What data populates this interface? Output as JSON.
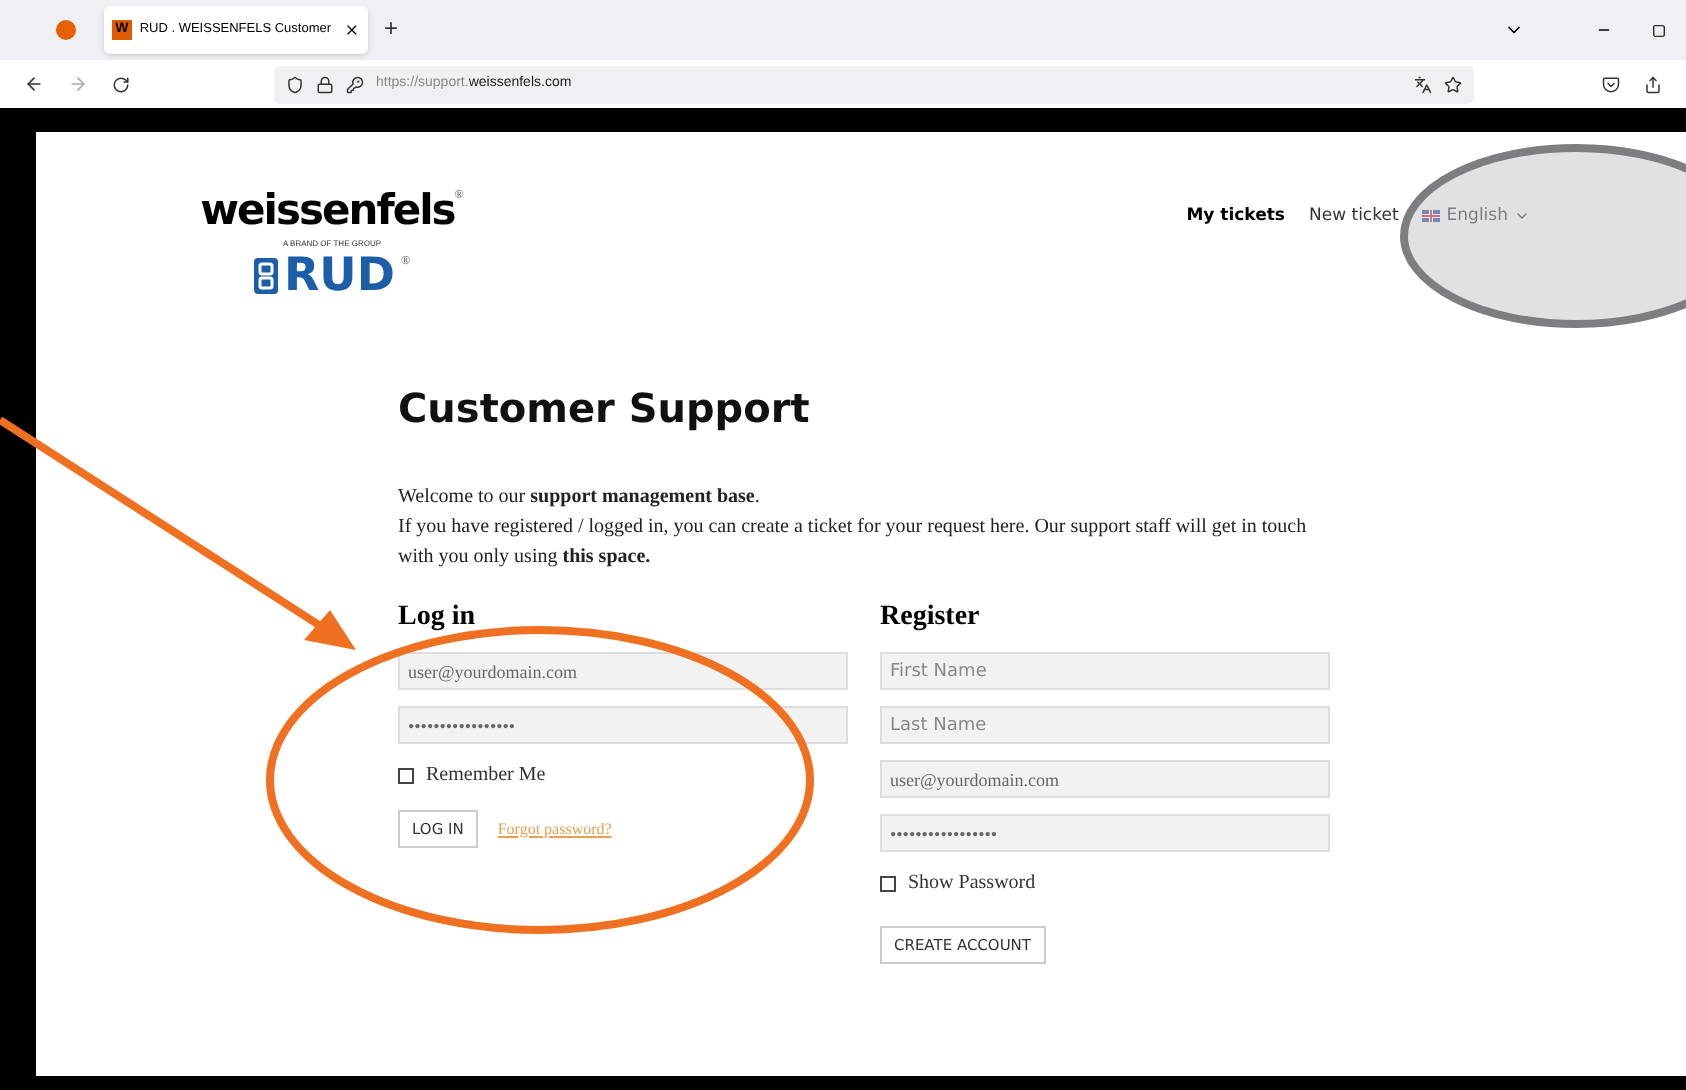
{
  "browser": {
    "tab": {
      "favicon": "W",
      "title": "RUD . WEISSENFELS Customer",
      "selected": true
    },
    "new_tab": "+",
    "address": {
      "prefix": "https://support.",
      "domain": "weissenfels.com"
    }
  },
  "logo": {
    "brand": "weissenfels",
    "registered": "®",
    "tagline": "A BRAND OF THE GROUP",
    "group": "RUD",
    "group_registered": "®"
  },
  "nav": [
    {
      "label": "My tickets",
      "selected": true
    },
    {
      "label": "New ticket",
      "selected": false
    },
    {
      "label": "English",
      "kind": "language"
    }
  ],
  "title": "Customer Support",
  "intro": [
    "Welcome to our **support management base**.",
    "If you have registered / logged in, you can create a ticket for your request here. Our support staff will get in touch with you only using **this space.**"
  ],
  "login": {
    "heading": "Log in",
    "fields": [
      {
        "value": "user@yourdomain.com"
      },
      {
        "value": "•••••••••••••••••"
      }
    ],
    "remember": {
      "label": "Remember Me",
      "checked": false
    },
    "button": "LOG IN",
    "forgot": "Forgot password?"
  },
  "register": {
    "heading": "Register",
    "fields": [
      {
        "placeholder": "First Name"
      },
      {
        "placeholder": "Last Name"
      },
      {
        "value": "user@yourdomain.com"
      },
      {
        "value": "•••••••••••••••••"
      }
    ],
    "show_password": {
      "label": "Show Password",
      "checked": false
    },
    "button": "CREATE ACCOUNT"
  }
}
